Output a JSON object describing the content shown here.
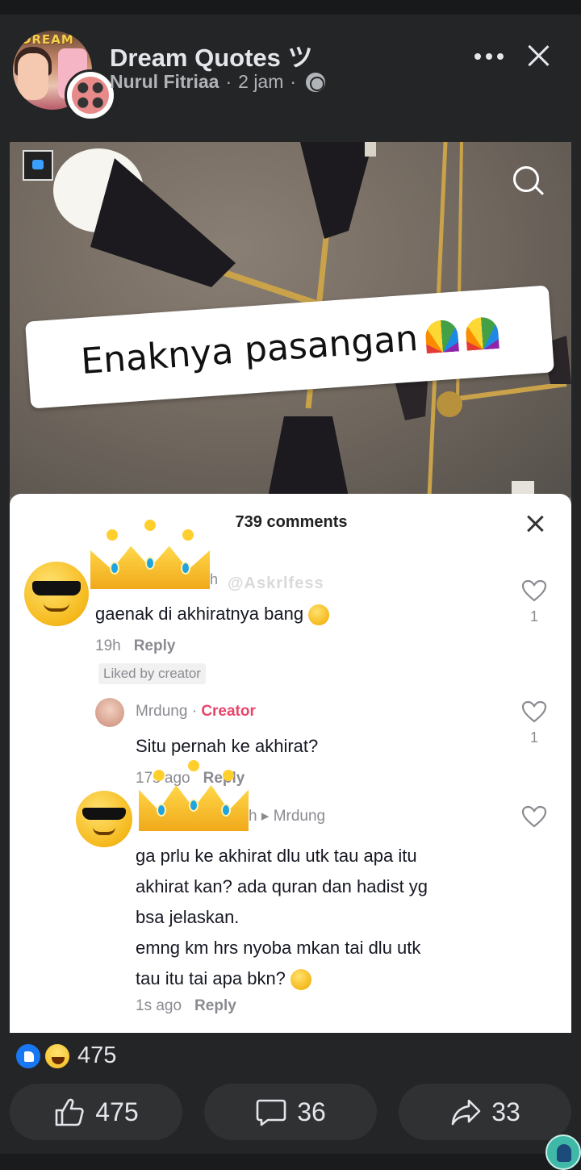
{
  "header": {
    "page_name": "Dream Quotes ツ",
    "avatar_badge": "DREAM",
    "author": "Nurul Fitriaa",
    "separator": "·",
    "time": "2 jam",
    "privacy_icon": "globe-icon",
    "more_icon": "more-icon",
    "close_icon": "close-icon"
  },
  "media": {
    "caption": "Enaknya pasangan",
    "caption_icons": [
      "rainbow-icon",
      "rainbow-icon"
    ],
    "search_icon": "search-icon"
  },
  "comments_panel": {
    "title": "739 comments",
    "watermark": "@Askrlfess",
    "comments": [
      {
        "avatar_icon": "sunglasses-emoji-icon",
        "name_overlay_icon": "crown-icon",
        "name_fragment": "h",
        "text": "gaenak di akhiratnya bang",
        "text_emoji": "laughing-emoji-icon",
        "time": "19h",
        "reply_label": "Reply",
        "badge": "Liked by creator",
        "likes": "1"
      },
      {
        "avatar_icon": "user-avatar",
        "name": "Mrdung",
        "separator": "·",
        "role": "Creator",
        "text": "Situ pernah ke akhirat?",
        "time_partial": "17s ago",
        "reply_label": "Reply",
        "likes": "1"
      },
      {
        "avatar_icon": "sunglasses-emoji-icon",
        "name_overlay_icon": "crown-icon",
        "name_fragment": "h",
        "reply_to_arrow": "▸",
        "reply_to": "Mrdung",
        "lines": [
          "ga prlu ke akhirat dlu utk tau apa itu",
          "akhirat kan? ada quran dan hadist yg",
          "bsa jelaskan.",
          "emng km hrs nyoba mkan tai dlu utk",
          "tau itu tai apa bkn?"
        ],
        "text_emoji": "laughing-emoji-icon",
        "time": "1s ago",
        "reply_label": "Reply"
      }
    ]
  },
  "reactions": {
    "icons": [
      "like-reaction-icon",
      "haha-reaction-icon"
    ],
    "count": "475"
  },
  "actions": {
    "like_count": "475",
    "comment_count": "36",
    "share_count": "33"
  },
  "colors": {
    "background": "#242526",
    "text_primary": "#e4e6eb",
    "text_secondary": "#b0b3b8",
    "creator_accent": "#e8456b",
    "like_blue": "#1877f2"
  }
}
